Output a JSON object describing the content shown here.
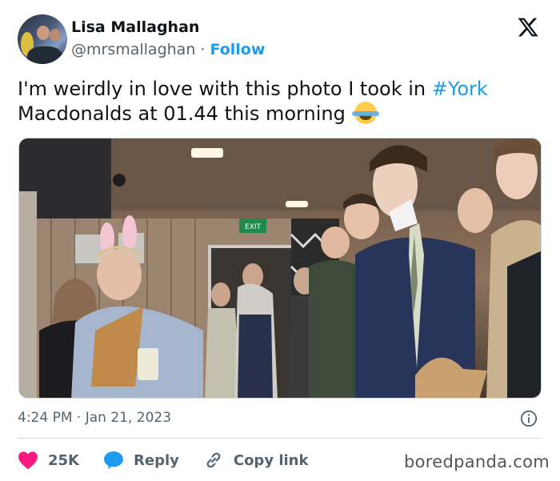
{
  "author": {
    "name": "Lisa Mallaghan",
    "handle": "@mrsmallaghan",
    "separator": "·",
    "follow_label": "Follow"
  },
  "tweet": {
    "text_before": "I'm weirdly in love with this photo I took in ",
    "hashtag": "#York",
    "text_after": " Macdonalds at 01.44 this morning ",
    "emoji": "face-with-tears-of-joy"
  },
  "photo": {
    "exit_sign": "EXIT",
    "description_icon": "photo"
  },
  "meta": {
    "timestamp": "4:24 PM · Jan 21, 2023"
  },
  "actions": {
    "likes_count": "25K",
    "reply_label": "Reply",
    "copy_link_label": "Copy link"
  },
  "watermark": "boredpanda.com",
  "colors": {
    "accent": "#1d9bf0",
    "like": "#f91880",
    "muted": "#536471",
    "text": "#0f1419"
  }
}
